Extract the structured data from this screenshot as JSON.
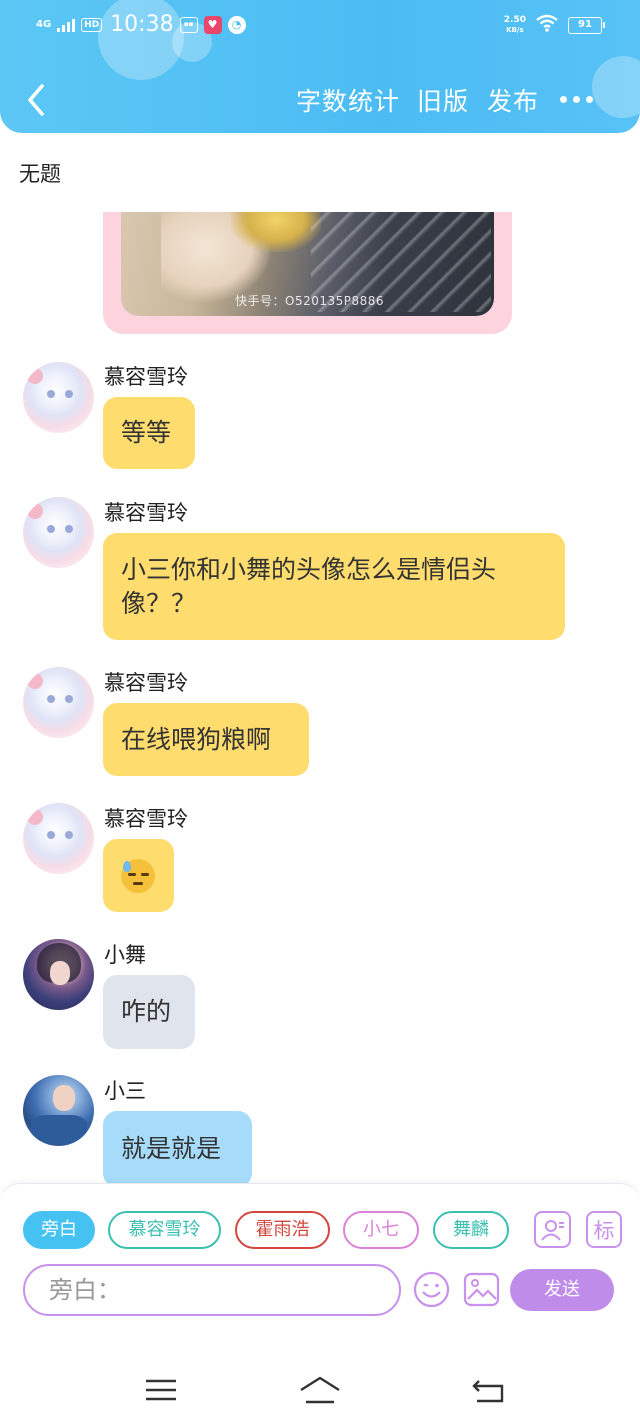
{
  "status_bar": {
    "network": "4G",
    "hd": "HD",
    "time": "10:38",
    "speed_value": "2.50",
    "speed_unit": "KB/s",
    "battery": "91"
  },
  "header": {
    "back_icon": "chevron-left-icon",
    "actions": {
      "word_count": "字数统计",
      "old_version": "旧版",
      "publish": "发布"
    },
    "more_icon": "more-dots-icon"
  },
  "document": {
    "title": "无题"
  },
  "image_card": {
    "watermark": "快手号：O520135P8886"
  },
  "messages": [
    {
      "name": "慕容雪玲",
      "text": "等等"
    },
    {
      "name": "慕容雪玲",
      "text": "小三你和小舞的头像怎么是情侣头像？？"
    },
    {
      "name": "慕容雪玲",
      "text": "在线喂狗粮啊"
    },
    {
      "name": "慕容雪玲",
      "text": "",
      "emoji": "sweat-face-emoji"
    },
    {
      "name": "小舞",
      "text": "咋的"
    },
    {
      "name": "小三",
      "text": "就是就是"
    }
  ],
  "characters": [
    {
      "label": "旁白",
      "active": true
    },
    {
      "label": "慕容雪玲",
      "color": "#3bbfb0"
    },
    {
      "label": "霍雨浩",
      "color": "#d2473e"
    },
    {
      "label": "小七",
      "color": "#d983d9"
    },
    {
      "label": "舞麟",
      "color": "#3bbfb0"
    }
  ],
  "composer": {
    "placeholder": "旁白：",
    "send_label": "发送",
    "tag_label": "标"
  },
  "colors": {
    "header": "#4bbcf3",
    "bubble_yellow": "#fedc6d",
    "bubble_gray": "#e0e4ec",
    "bubble_blue": "#a6dcfa",
    "accent_purple": "#c791ec",
    "send_button": "#c08ce9"
  }
}
